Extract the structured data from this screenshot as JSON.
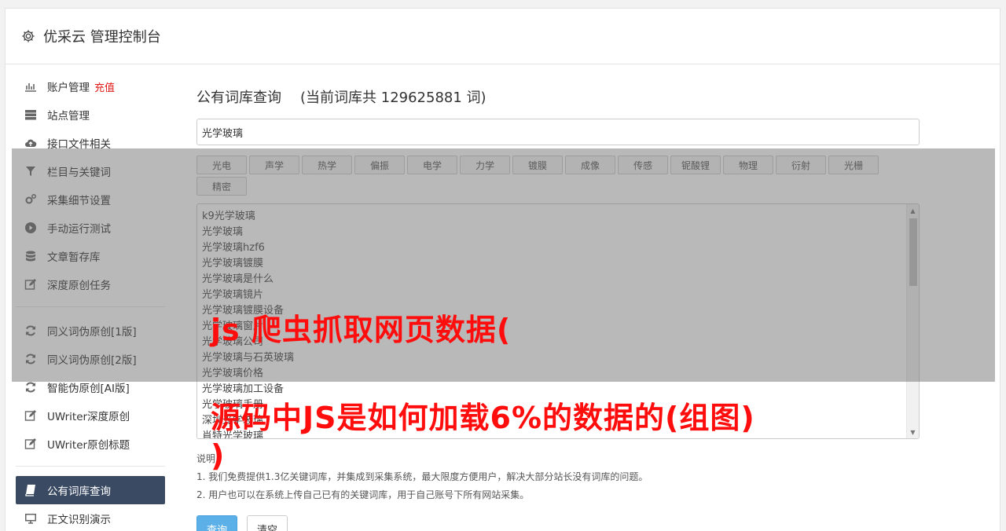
{
  "header": {
    "title": "优采云 管理控制台",
    "icon": "gear-icon"
  },
  "sidebar": {
    "items": [
      {
        "label": "账户管理",
        "badge": "充值",
        "icon": "bar-chart-icon"
      },
      {
        "label": "站点管理",
        "icon": "server-icon"
      },
      {
        "label": "接口文件相关",
        "icon": "cloud-upload-icon"
      },
      {
        "label": "栏目与关键词",
        "icon": "filter-icon"
      },
      {
        "label": "采集细节设置",
        "icon": "gears-icon"
      },
      {
        "label": "手动运行测试",
        "icon": "play-icon"
      },
      {
        "label": "文章暂存库",
        "icon": "database-icon"
      },
      {
        "label": "深度原创任务",
        "icon": "edit-icon"
      }
    ],
    "items2": [
      {
        "label": "同义词伪原创[1版]",
        "icon": "refresh-icon"
      },
      {
        "label": "同义词伪原创[2版]",
        "icon": "refresh-icon"
      },
      {
        "label": "智能伪原创[AI版]",
        "icon": "refresh-icon"
      },
      {
        "label": "UWriter深度原创",
        "icon": "edit-icon"
      },
      {
        "label": "UWriter原创标题",
        "icon": "edit-icon"
      }
    ],
    "items3": [
      {
        "label": "公有词库查询",
        "icon": "book-icon",
        "active": true
      },
      {
        "label": "正文识别演示",
        "icon": "monitor-icon"
      }
    ]
  },
  "main": {
    "title": "公有词库查询",
    "count_text": "(当前词库共 129625881 词)",
    "search_value": "光学玻璃",
    "tags": [
      "光电",
      "声学",
      "热学",
      "偏振",
      "电学",
      "力学",
      "镀膜",
      "成像",
      "传感",
      "铌酸锂",
      "物理",
      "衍射",
      "光栅",
      "精密"
    ],
    "results": [
      "k9光学玻璃",
      "光学玻璃",
      "光学玻璃hzf6",
      "光学玻璃镀膜",
      "光学玻璃是什么",
      "光学玻璃镜片",
      "光学玻璃镀膜设备",
      "光学玻璃窗片",
      "光学玻璃公司",
      "光学玻璃与石英玻璃",
      "光学玻璃价格",
      "光学玻璃加工设备",
      "光学玻璃手册",
      "深圳光学玻璃",
      "肖特光学玻璃"
    ],
    "notes_title": "说明：",
    "notes": [
      "1. 我们免费提供1.3亿关键词库，并集成到采集系统，最大限度方便用户，解决大部分站长没有词库的问题。",
      "2. 用户也可以在系统上传自己已有的关键词库，用于自己账号下所有网站采集。"
    ],
    "query_button": "查询",
    "clear_button": "清空"
  },
  "overlay": {
    "line1": "js 爬虫抓取网页数据(",
    "line2": "源码中JS是如何加载6%的数据的(组图)",
    "line3": ")"
  }
}
